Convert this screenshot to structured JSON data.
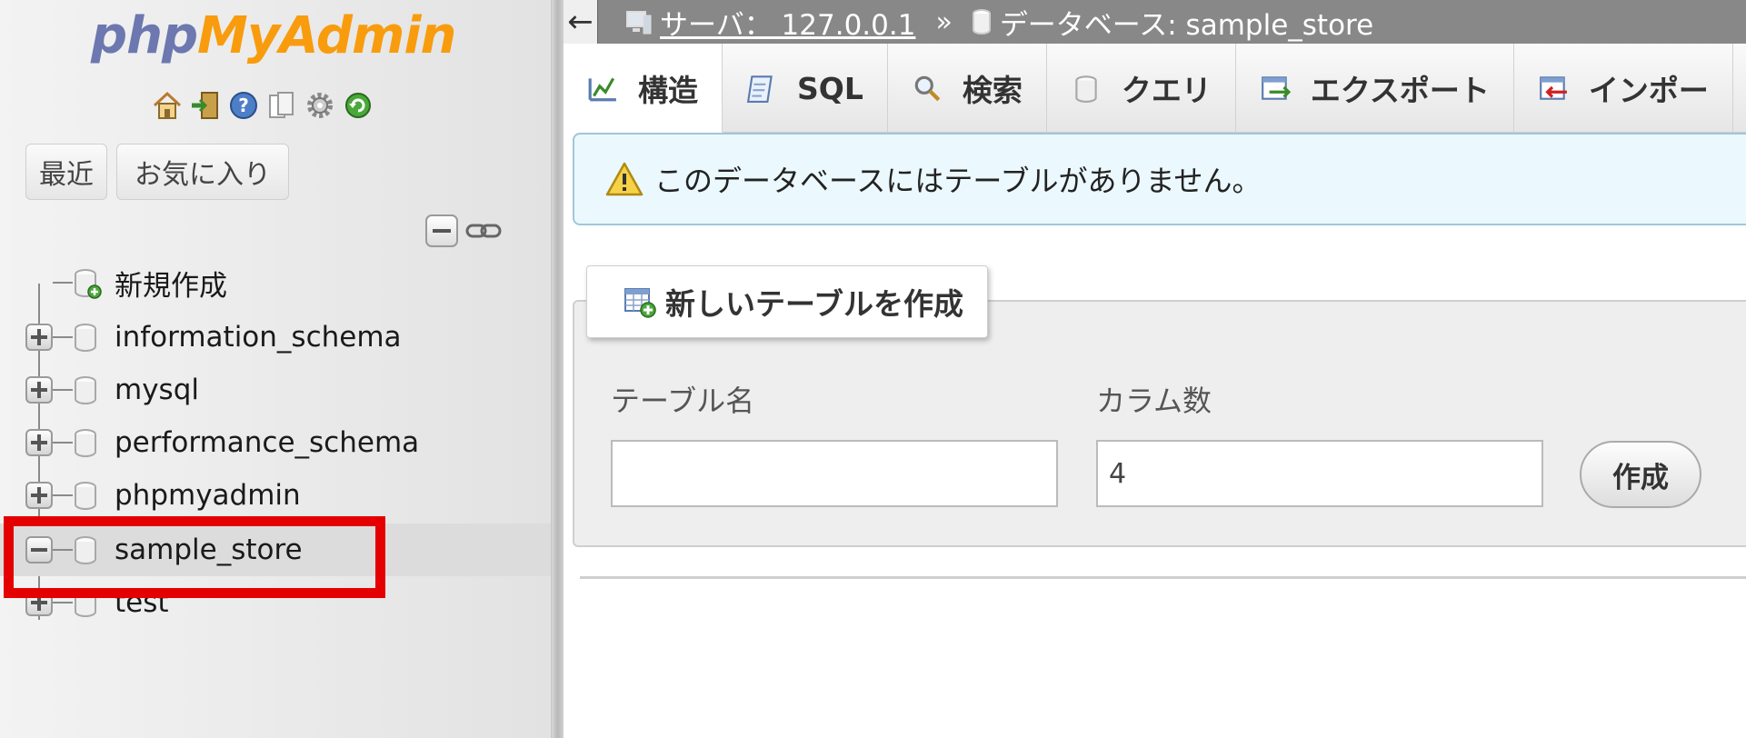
{
  "logo": {
    "php": "php",
    "my_admin": "MyAdmin"
  },
  "nav": {
    "icons": [
      "home-icon",
      "logout-icon",
      "help-icon",
      "docs-icon",
      "settings-icon",
      "reload-icon"
    ],
    "recent_label": "最近",
    "favorites_label": "お気に入り",
    "tree": [
      {
        "label": "新規作成",
        "type": "new"
      },
      {
        "label": "information_schema",
        "type": "db",
        "expanded": false
      },
      {
        "label": "mysql",
        "type": "db",
        "expanded": false
      },
      {
        "label": "performance_schema",
        "type": "db",
        "expanded": false
      },
      {
        "label": "phpmyadmin",
        "type": "db",
        "expanded": false
      },
      {
        "label": "sample_store",
        "type": "db",
        "expanded": true,
        "selected": true
      },
      {
        "label": "test",
        "type": "db",
        "expanded": false
      }
    ]
  },
  "breadcrumb": {
    "server": "サーバ： 127.0.0.1",
    "separator": "»",
    "database": "データベース: sample_store"
  },
  "tabs": [
    {
      "label": "構造",
      "icon": "structure-icon",
      "active": true
    },
    {
      "label": "SQL",
      "icon": "sql-icon",
      "active": false
    },
    {
      "label": "検索",
      "icon": "search-icon",
      "active": false
    },
    {
      "label": "クエリ",
      "icon": "query-icon",
      "active": false
    },
    {
      "label": "エクスポート",
      "icon": "export-icon",
      "active": false
    },
    {
      "label": "インポー",
      "icon": "import-icon",
      "active": false
    }
  ],
  "notice": {
    "text": "このデータベースにはテーブルがありません。"
  },
  "create_table": {
    "legend": "新しいテーブルを作成",
    "table_name_label": "テーブル名",
    "table_name_value": "",
    "columns_label": "カラム数",
    "columns_value": "4",
    "create_button": "作成"
  },
  "colors": {
    "logo_php": "#6c78af",
    "logo_myadmin": "#f89c0e",
    "highlight": "#e40000",
    "topbar": "#888888"
  }
}
